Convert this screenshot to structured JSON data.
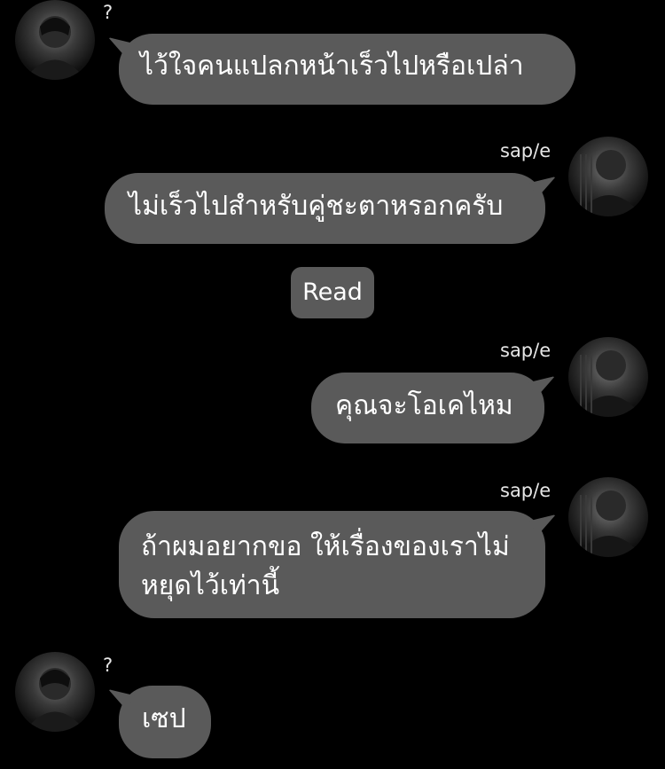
{
  "chat": {
    "messages": [
      {
        "sender": "?",
        "side": "left",
        "text": "ไว้ใจคนแปลกหน้าเร็วไปหรือเปล่า"
      },
      {
        "sender": "sap/e",
        "side": "right",
        "text": "ไม่เร็วไปสำหรับคู่ชะตาหรอกครับ"
      },
      {
        "sender": "sap/e",
        "side": "right",
        "text": "คุณจะโอเคไหม"
      },
      {
        "sender": "sap/e",
        "side": "right",
        "text_lines": [
          "ถ้าผมอยากขอ ให้เรื่องของเราไม่",
          "หยุดไว้เท่านี้"
        ]
      },
      {
        "sender": "?",
        "side": "left",
        "text": "เซป"
      }
    ],
    "read_label": "Read"
  }
}
